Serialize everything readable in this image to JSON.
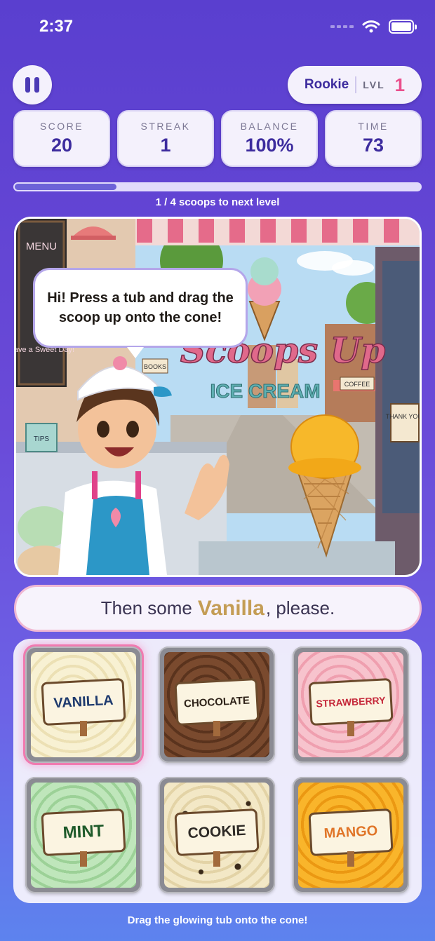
{
  "status_bar": {
    "time": "2:37"
  },
  "header": {
    "rank": "Rookie",
    "level_label": "LVL",
    "level": "1"
  },
  "stats": [
    {
      "label": "SCORE",
      "value": "20"
    },
    {
      "label": "STREAK",
      "value": "1"
    },
    {
      "label": "BALANCE",
      "value": "100%"
    },
    {
      "label": "TIME",
      "value": "73"
    }
  ],
  "progress": {
    "text": "1 / 4 scoops to next level",
    "fraction": 0.25
  },
  "scene": {
    "speech": "Hi! Press a tub and drag the scoop up onto the cone!",
    "shop_sign_line1": "Scoops Up",
    "shop_sign_line2": "ICE CREAM",
    "menu_board": "MENU",
    "chalk_note": "Have a Sweet Day!",
    "tips_jar": "TIPS",
    "coffee_sign": "COFFEE",
    "thank_you_sign": "THANK YOU!",
    "books_sign": "BOOKS"
  },
  "order": {
    "prefix": "Then some",
    "flavor": "Vanilla",
    "suffix": ", please."
  },
  "tubs": [
    {
      "label": "VANILLA",
      "color": "#f5ecc8",
      "accent": "#1e3a6e",
      "selected": true
    },
    {
      "label": "CHOCOLATE",
      "color": "#6b3f26",
      "accent": "#3a2416",
      "selected": false
    },
    {
      "label": "STRAWBERRY",
      "color": "#f5b8c4",
      "accent": "#c5283a",
      "selected": false
    },
    {
      "label": "MINT",
      "color": "#b5dfb1",
      "accent": "#1e5a2a",
      "selected": false
    },
    {
      "label": "COOKIE",
      "color": "#f0e4c0",
      "accent": "#2e2a26",
      "selected": false
    },
    {
      "label": "MANGO",
      "color": "#f7ac1e",
      "accent": "#e07528",
      "selected": false
    }
  ],
  "footer_hint": "Drag the glowing tub onto the cone!"
}
